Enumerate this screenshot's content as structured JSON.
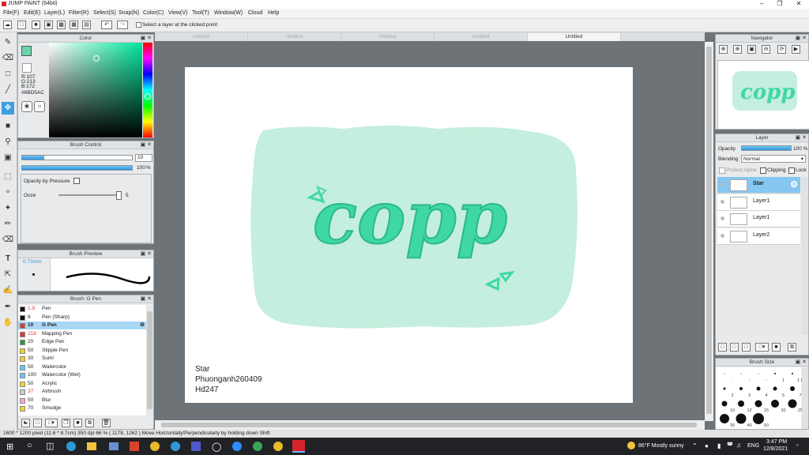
{
  "app": {
    "title": "JUMP PAINT (64bit)"
  },
  "menu": [
    "File(F)",
    "Edit(E)",
    "Layer(L)",
    "Filter(R)",
    "Select(S)",
    "Snap(N)",
    "Color(C)",
    "View(V)",
    "Tool(T)",
    "Window(W)",
    "Cloud",
    "Help"
  ],
  "toolbar": {
    "hint": "Select a layer at the clicked point"
  },
  "doc_tabs": [
    "Untitled",
    "Untitled",
    "Untitled",
    "Untitled",
    "Untitled"
  ],
  "color_panel": {
    "title": "Color",
    "r": "R:107",
    "g": "G:213",
    "b": "B:172",
    "hex": "#6BD5AC",
    "current": "#6bd5ac"
  },
  "brush_control": {
    "title": "Brush Control",
    "size": "10",
    "opacity": "100",
    "opacity_unit": "%",
    "opacity_by_pressure": "Opacity by Pressure",
    "ooze_label": "Ooze",
    "ooze_value": "5"
  },
  "brush_preview": {
    "title": "Brush Preview",
    "size": "0.73mm"
  },
  "brush_list": {
    "title": "Brush: G Pen",
    "items": [
      {
        "size": "1.9",
        "name": "Pen",
        "color": "#111111",
        "size_color": "#d23c3c"
      },
      {
        "size": "8",
        "name": "Pen (Sharp)",
        "color": "#111111",
        "size_color": "#222222"
      },
      {
        "size": "10",
        "name": "G Pen",
        "color": "#d23c3c",
        "size_color": "#222222",
        "selected": true
      },
      {
        "size": "218",
        "name": "Mapping Pen",
        "color": "#d23c3c",
        "size_color": "#d23c3c"
      },
      {
        "size": "20",
        "name": "Edge Pen",
        "color": "#2e9b37",
        "size_color": "#222222"
      },
      {
        "size": "50",
        "name": "Stipple Pen",
        "color": "#f2d22b",
        "size_color": "#222222"
      },
      {
        "size": "30",
        "name": "Sumi",
        "color": "#f2d22b",
        "size_color": "#222222"
      },
      {
        "size": "50",
        "name": "Watercolor",
        "color": "#5fc8ef",
        "size_color": "#222222"
      },
      {
        "size": "100",
        "name": "Watercolor (Wet)",
        "color": "#5fc8ef",
        "size_color": "#222222"
      },
      {
        "size": "50",
        "name": "Acrylic",
        "color": "#f2d22b",
        "size_color": "#222222"
      },
      {
        "size": "37",
        "name": "Airbrush",
        "color": "#cccccc",
        "size_color": "#d23c3c"
      },
      {
        "size": "50",
        "name": "Blur",
        "color": "#f4a9d9",
        "size_color": "#222222"
      },
      {
        "size": "70",
        "name": "Smudge",
        "color": "#f2d22b",
        "size_color": "#222222"
      }
    ]
  },
  "canvas": {
    "caption_line1": "Star",
    "caption_line2": "Phuonganh260409",
    "caption_line3": "Hd247",
    "art_text": "copp",
    "bg_color": "#c4eedd",
    "letter_color": "#3fd8a3"
  },
  "navigator": {
    "title": "Navigator"
  },
  "layer_panel": {
    "title": "Layer",
    "opacity_label": "Opacity",
    "opacity_value": "100 %",
    "blending_label": "Blending",
    "blending_value": "Normal",
    "protect_alpha": "Protect Alpha",
    "clipping": "Clipping",
    "lock": "Lock",
    "layers": [
      {
        "name": "Star",
        "selected": true
      },
      {
        "name": "Layer1"
      },
      {
        "name": "Layer1"
      },
      {
        "name": "Layer2"
      }
    ]
  },
  "brush_size": {
    "title": "Brush Size",
    "sizes": [
      ".",
      "-",
      "-",
      "1",
      "1.5",
      "2",
      "3",
      "4",
      "5",
      "7",
      "10",
      "12",
      "15",
      "20",
      "25",
      "30",
      "40",
      "50"
    ]
  },
  "status": {
    "text": "1600 * 1200 pixel   (11.6 * 8.7cm)   350 dpi   66 %   ( 1178, 1262 )   Move Horizontally/Perpendicularly by holding down Shift"
  },
  "taskbar": {
    "weather": "86°F  Mostly sunny",
    "lang": "ENG",
    "time": "3:47 PM",
    "date": "12/8/2021"
  }
}
